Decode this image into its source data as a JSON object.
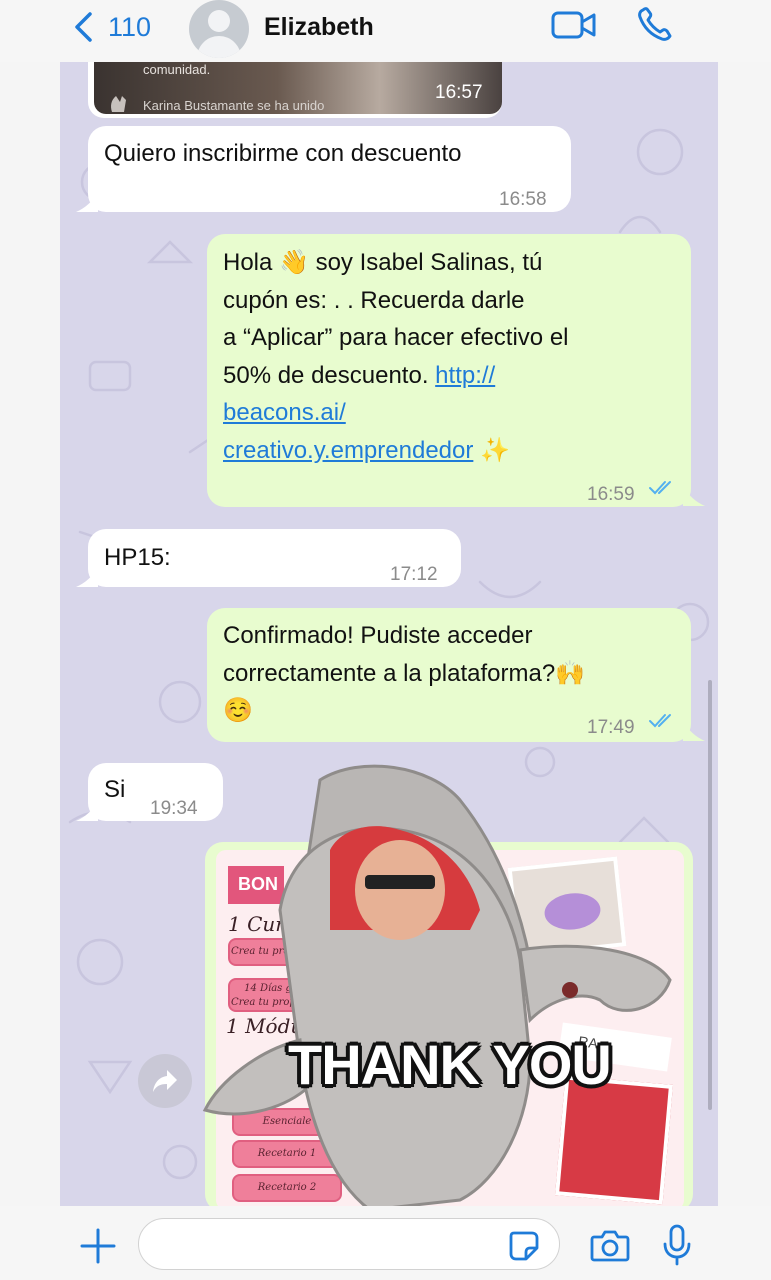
{
  "header": {
    "back_count": "110",
    "contact_name": "Elizabeth",
    "icons": [
      "chevron-left-icon",
      "avatar-icon",
      "video-call-icon",
      "phone-call-icon"
    ]
  },
  "messages": {
    "media_preview": {
      "caption": "comunidad.",
      "joined_text": "Karina Bustamante se ha unido",
      "time": "16:57"
    },
    "m1": {
      "text": "Quiero inscribirme con descuento",
      "time": "16:58"
    },
    "m2": {
      "line1": "Hola 👋 soy Isabel Salinas, tú",
      "line2": "cupón es: .            . Recuerda darle",
      "line3": "a “Aplicar” para hacer efectivo el",
      "line4_text": "50% de descuento.",
      "link1": "http://",
      "link2": "beacons.ai/",
      "link3": "creativo.y.emprendedor",
      "sparkle": "✨",
      "time": "16:59"
    },
    "m3": {
      "text": "HP15:",
      "time": "17:12"
    },
    "m4": {
      "line1": "Confirmado! Pudiste acceder",
      "line2": "correctamente a la plataforma?🙌",
      "line3": "☺️",
      "time": "17:49"
    },
    "m5": {
      "text": "Si",
      "time": "19:34"
    },
    "image_message": {
      "bon": "BON",
      "curso": "1 Cur",
      "pill1": "Crea tu propia",
      "pill2a": "14 Días g",
      "pill2b": "Crea tu propia",
      "modulo": "1 Módulo",
      "pill3": "Esenciale",
      "pill4": "Recetario 1",
      "pill5": "Recetario 2",
      "label": "RA"
    },
    "sticker_text": "THANK YOU"
  },
  "footer": {
    "placeholder": "",
    "icons": [
      "plus-icon",
      "sticker-icon",
      "camera-icon",
      "microphone-icon"
    ]
  },
  "colors": {
    "accent": "#1f7bd8",
    "chat_bg": "#d8d6ea",
    "incoming": "#ffffff",
    "outgoing": "#e8fccf",
    "read_ticks": "#53b0f0"
  }
}
